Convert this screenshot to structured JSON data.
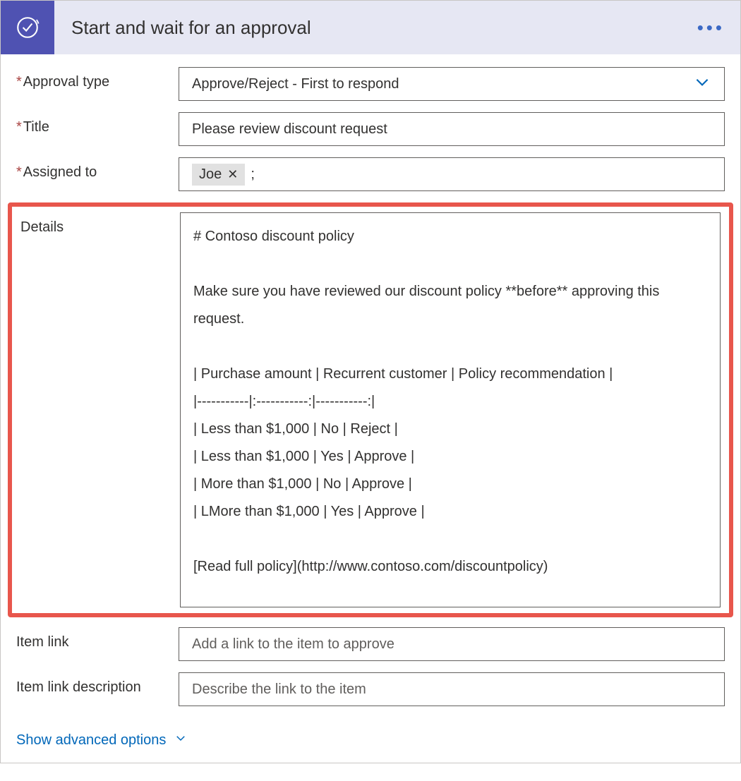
{
  "header": {
    "title": "Start and wait for an approval"
  },
  "fields": {
    "approval_type": {
      "label": "Approval type",
      "required": true,
      "value": "Approve/Reject - First to respond"
    },
    "title": {
      "label": "Title",
      "required": true,
      "value": "Please review discount request"
    },
    "assigned_to": {
      "label": "Assigned to",
      "required": true,
      "chip": "Joe",
      "separator": ";"
    },
    "details": {
      "label": "Details",
      "value": "# Contoso discount policy\n\nMake sure you have reviewed our discount policy **before** approving this request.\n\n| Purchase amount | Recurrent customer | Policy recommendation |\n|-----------|:-----------:|-----------:|\n| Less than $1,000 | No | Reject |\n| Less than $1,000 | Yes | Approve |\n| More than $1,000 | No | Approve |\n| LMore than $1,000 | Yes | Approve |\n\n[Read full policy](http://www.contoso.com/discountpolicy)"
    },
    "item_link": {
      "label": "Item link",
      "placeholder": "Add a link to the item to approve"
    },
    "item_link_desc": {
      "label": "Item link description",
      "placeholder": "Describe the link to the item"
    }
  },
  "footer": {
    "advanced": "Show advanced options"
  }
}
